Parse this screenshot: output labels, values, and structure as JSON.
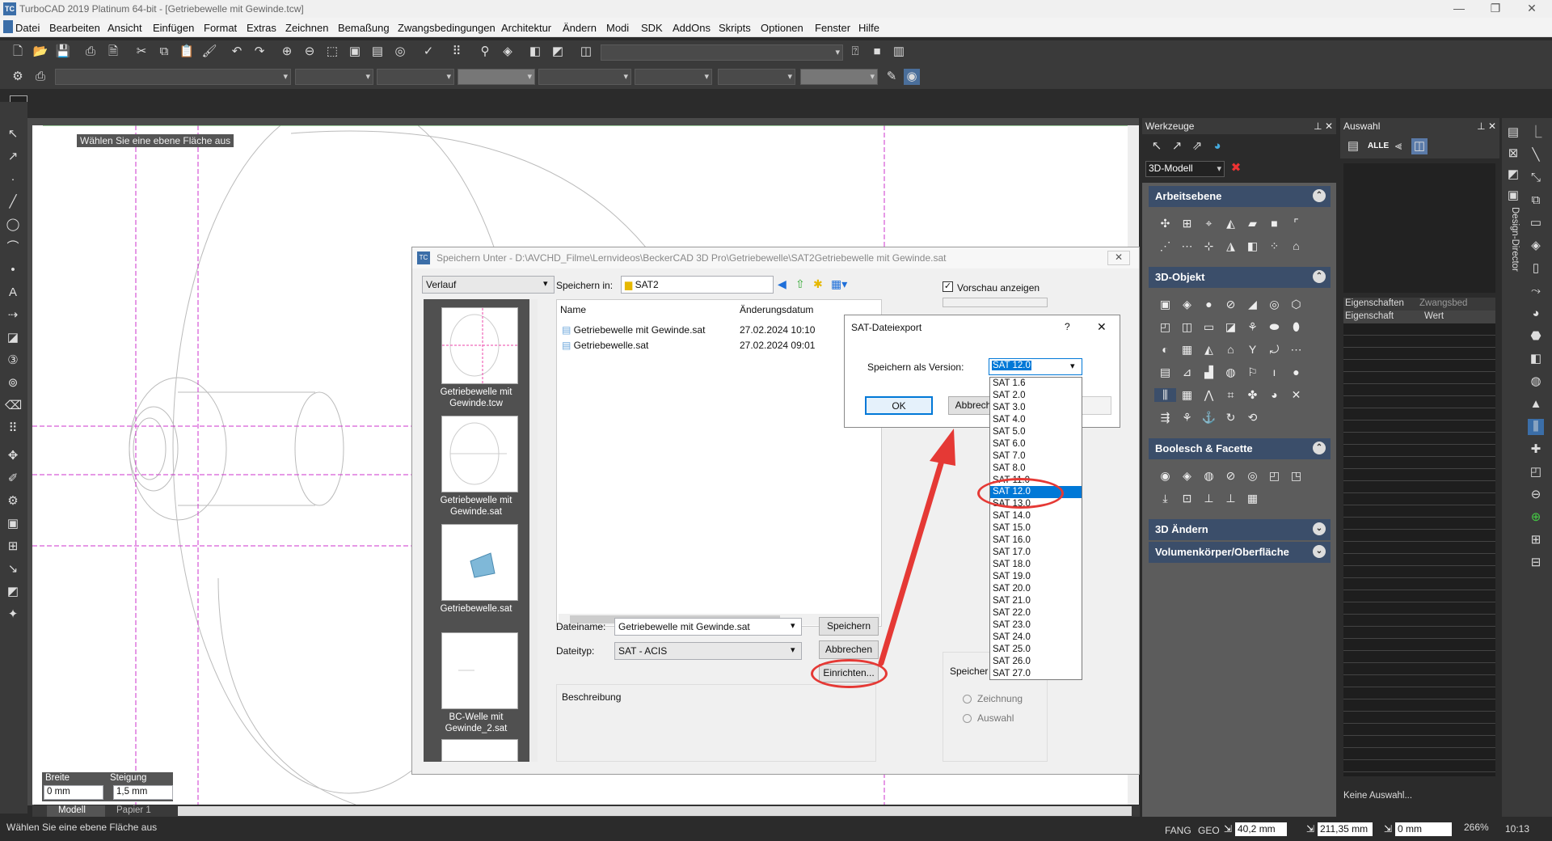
{
  "window": {
    "title": "TurboCAD 2019 Platinum 64-bit - [Getriebewelle mit Gewinde.tcw]",
    "logo": "TC"
  },
  "menu": [
    "Datei",
    "Bearbeiten",
    "Ansicht",
    "Einfügen",
    "Format",
    "Extras",
    "Zeichnen",
    "Bemaßung",
    "Zwangsbedingungen",
    "Architektur",
    "Ändern",
    "Modi",
    "SDK",
    "AddOns",
    "Skripts",
    "Optionen",
    "Fenster",
    "Hilfe"
  ],
  "canvas": {
    "tooltip": "Wählen Sie eine ebene Fläche aus"
  },
  "inputs": {
    "breite_label": "Breite",
    "breite_value": "0 mm",
    "steigung_label": "Steigung",
    "steigung_value": "1,5 mm"
  },
  "tabs": {
    "model": "Modell",
    "paper": "Papier 1"
  },
  "status": {
    "prompt": "Wählen Sie eine ebene Fläche aus",
    "fang": "FANG",
    "geo": "GEO",
    "x": "40,2 mm",
    "y": "211,35 mm",
    "z": "0 mm",
    "zoom": "266%",
    "time": "10:13"
  },
  "tools": {
    "title": "Werkzeuge",
    "mode": "3D-Modell",
    "sections": [
      "Arbeitsebene",
      "3D-Objekt",
      "Boolesch & Facette",
      "3D Ändern",
      "Volumenkörper/Oberfläche"
    ],
    "alle": "ALLE"
  },
  "auswahl": {
    "title": "Auswahl",
    "tab1": "Eigenschaften",
    "tab2": "Zwangsbed",
    "col1": "Eigenschaft",
    "col2": "Wert",
    "none": "Keine Auswahl..."
  },
  "design_director": "Design-Director",
  "savedlg": {
    "title": "Speichern Unter - D:\\AVCHD_Filme\\Lernvideos\\BeckerCAD 3D Pro\\Getriebewelle\\SAT2Getriebewelle mit Gewinde.sat",
    "history": "Verlauf",
    "save_in_label": "Speichern in:",
    "folder": "SAT2",
    "col_name": "Name",
    "col_date": "Änderungsdatum",
    "files": [
      {
        "name": "Getriebewelle mit Gewinde.sat",
        "date": "27.02.2024 10:10"
      },
      {
        "name": "Getriebewelle.sat",
        "date": "27.02.2024 09:01"
      }
    ],
    "thumbs": [
      "Getriebewelle mit Gewinde.tcw",
      "Getriebewelle mit Gewinde.sat",
      "Getriebewelle.sat",
      "BC-Welle mit Gewinde_2.sat"
    ],
    "filename_label": "Dateiname:",
    "filename": "Getriebewelle mit Gewinde.sat",
    "filetype_label": "Dateityp:",
    "filetype": "SAT - ACIS",
    "save": "Speichern",
    "cancel": "Abbrechen",
    "setup": "Einrichten...",
    "desc": "Beschreibung",
    "preview": "Vorschau anzeigen",
    "save_trunc": "Speicher",
    "radio1": "Zeichnung",
    "radio2": "Auswahl"
  },
  "satdlg": {
    "title": "SAT-Dateiexport",
    "help": "?",
    "close": "✕",
    "label": "Speichern als Version:",
    "selected": "SAT 12.0",
    "ok": "OK",
    "cancel": "Abbrech",
    "versions": [
      "SAT 1.6",
      "SAT 2.0",
      "SAT 3.0",
      "SAT 4.0",
      "SAT 5.0",
      "SAT 6.0",
      "SAT 7.0",
      "SAT 8.0",
      "SAT 11.0",
      "SAT 12.0",
      "SAT 13.0",
      "SAT 14.0",
      "SAT 15.0",
      "SAT 16.0",
      "SAT 17.0",
      "SAT 18.0",
      "SAT 19.0",
      "SAT 20.0",
      "SAT 21.0",
      "SAT 22.0",
      "SAT 23.0",
      "SAT 24.0",
      "SAT 25.0",
      "SAT 26.0",
      "SAT 27.0"
    ]
  },
  "colors": {
    "accent": "#0078d7",
    "annotation": "#e53935",
    "section": "#3b4e6a",
    "guide": "#cc33cc"
  }
}
